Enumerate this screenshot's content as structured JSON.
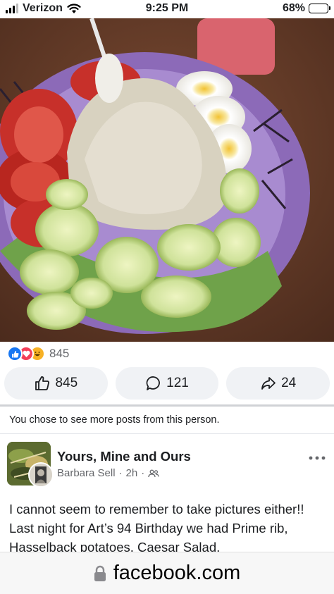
{
  "status_bar": {
    "carrier": "Verizon",
    "time": "9:25 PM",
    "battery_percent": "68%",
    "battery_level": 0.68,
    "icons": [
      "signal-icon",
      "wifi-icon",
      "battery-icon"
    ]
  },
  "photo": {
    "description_icon": "food-photo"
  },
  "reactions": {
    "icons": [
      "like-icon",
      "love-icon",
      "haha-icon"
    ],
    "count": "845"
  },
  "actions": {
    "like_count": "845",
    "comment_count": "121",
    "share_count": "24"
  },
  "notice": "You chose to see more posts from this person.",
  "post": {
    "group_name": "Yours, Mine and Ours",
    "author": "Barbara Sell",
    "separator": "·",
    "time": "2h",
    "text": "I cannot seem to remember to take pictures either!! Last night for Art’s 94 Birthday we had Prime rib, Hasselback potatoes, Caesar Salad,"
  },
  "url_bar": {
    "domain": "facebook.com"
  },
  "colors": {
    "accent": "#1877f2",
    "love": "#f33e58",
    "haha": "#f7b125",
    "button_bg": "#f0f2f5",
    "secondary_text": "#65676b"
  }
}
